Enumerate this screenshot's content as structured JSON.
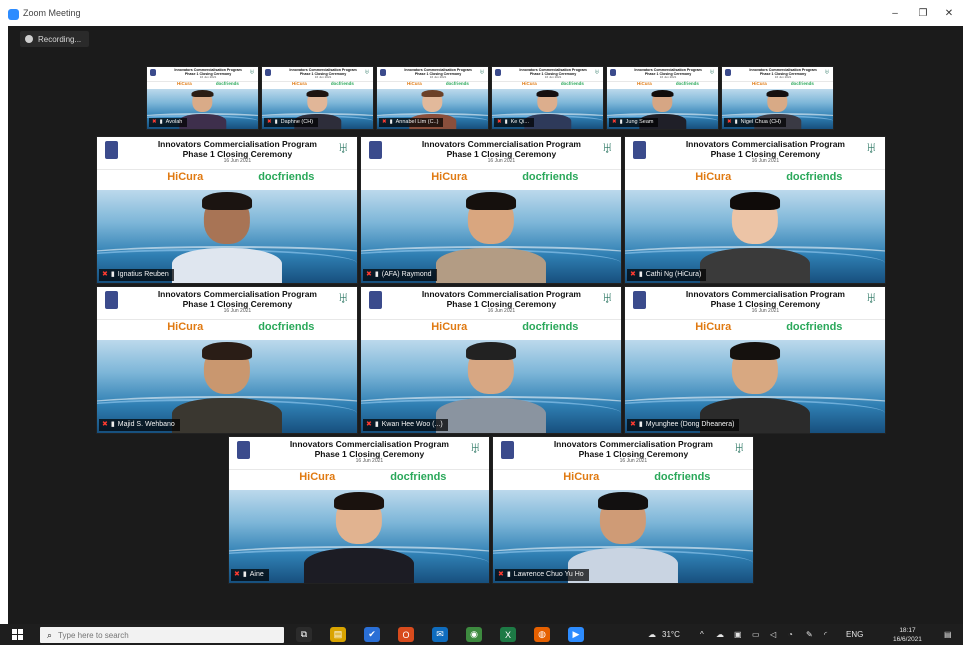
{
  "window": {
    "title": "Zoom Meeting",
    "controls": [
      "–",
      "❐",
      "✕"
    ]
  },
  "recording": {
    "label": "Recording..."
  },
  "slide": {
    "headline_line1": "Innovators Commercialisation Program",
    "headline_line2": "Phase 1 Closing Ceremony",
    "date_line": "16 Jun 2021",
    "partner_left": "HiCura",
    "partner_right": "docfriends"
  },
  "participants_top": [
    {
      "name": "Avolah",
      "skin": "#d9ab88",
      "hair": "#2b1d14",
      "shirt": "#3e2f4c"
    },
    {
      "name": "Daphne (CH)",
      "skin": "#e1b698",
      "hair": "#1e1410",
      "shirt": "#2d2d3a"
    },
    {
      "name": "Annabel Lim (C..)",
      "skin": "#e2b99b",
      "hair": "#6b4128",
      "shirt": "#8a4f3c"
    },
    {
      "name": "Ke Qi...",
      "skin": "#dcae8d",
      "hair": "#161010",
      "shirt": "#2e3a5a"
    },
    {
      "name": "Jung Seam",
      "skin": "#d6a684",
      "hair": "#120d0b",
      "shirt": "#1f1f28"
    },
    {
      "name": "Nigel Chua (CH)",
      "skin": "#d8aa86",
      "hair": "#151010",
      "shirt": "#3a3a44"
    }
  ],
  "participants_main": [
    {
      "name": "Ignatius Reuben",
      "skin": "#a87455",
      "hair": "#1b1411",
      "shirt": "#dfe6ef"
    },
    {
      "name": "(AFA) Raymond",
      "skin": "#d9a67f",
      "hair": "#15100d",
      "shirt": "#b39c84"
    },
    {
      "name": "Cathi Ng (HiCura)",
      "skin": "#ecc4a6",
      "hair": "#0f0b09",
      "shirt": "#3a3a3a"
    },
    {
      "name": "Majid S. Wehbano",
      "skin": "#c9976f",
      "hair": "#2a1d16",
      "shirt": "#3a3730"
    },
    {
      "name": "Kwan Hee Woo (...)",
      "skin": "#d7a783",
      "hair": "#222222",
      "shirt": "#8a94a0"
    },
    {
      "name": "Myunghee (Dong Dheanera)",
      "skin": "#d8a881",
      "hair": "#15110e",
      "shirt": "#2b2b2b"
    }
  ],
  "participants_bottom": [
    {
      "name": "Aine",
      "skin": "#e1b390",
      "hair": "#1a120e",
      "shirt": "#1c1c24"
    },
    {
      "name": "Lawrence Chuo Yu Ho",
      "skin": "#cf9b76",
      "hair": "#121010",
      "shirt": "#c9d4e2"
    }
  ],
  "taskbar": {
    "search_placeholder": "Type here to search",
    "weather": "31°C",
    "language": "ENG",
    "time": "18:17",
    "date": "16/6/2021",
    "apps": [
      {
        "icon": "task-view-icon",
        "glyph": "⧉",
        "color": "#2b2b2b"
      },
      {
        "icon": "file-explorer-icon",
        "glyph": "▤",
        "color": "#d9a400"
      },
      {
        "icon": "todo-icon",
        "glyph": "✔",
        "color": "#2a6fd6"
      },
      {
        "icon": "office-icon",
        "glyph": "O",
        "color": "#d84b1d"
      },
      {
        "icon": "outlook-icon",
        "glyph": "✉",
        "color": "#0f6cbd"
      },
      {
        "icon": "chrome-icon",
        "glyph": "◉",
        "color": "#3d8a3f"
      },
      {
        "icon": "excel-icon",
        "glyph": "X",
        "color": "#1d7a45"
      },
      {
        "icon": "firefox-icon",
        "glyph": "◍",
        "color": "#e66000"
      },
      {
        "icon": "zoom-icon",
        "glyph": "▶",
        "color": "#2d8cff"
      }
    ]
  }
}
